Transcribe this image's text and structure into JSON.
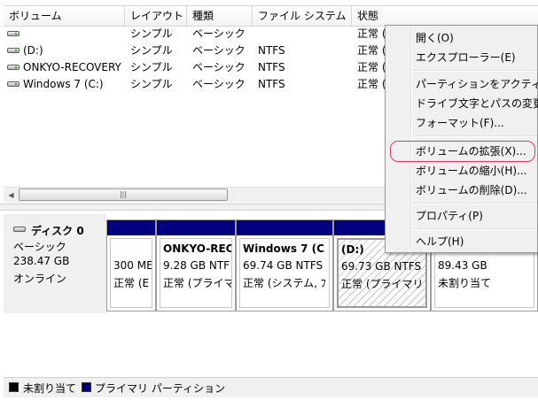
{
  "volume_list": {
    "columns": [
      "ボリューム",
      "レイアウト",
      "種類",
      "ファイル システム",
      "状態"
    ],
    "rows": [
      {
        "volume": "",
        "layout": "シンプル",
        "type": "ベーシック",
        "fs": "",
        "status": "正常 ("
      },
      {
        "volume": "(D:)",
        "layout": "シンプル",
        "type": "ベーシック",
        "fs": "NTFS",
        "status": "正常 ("
      },
      {
        "volume": "ONKYO-RECOVERY",
        "layout": "シンプル",
        "type": "ベーシック",
        "fs": "NTFS",
        "status": "正常 ("
      },
      {
        "volume": "Windows 7 (C:)",
        "layout": "シンプル",
        "type": "ベーシック",
        "fs": "NTFS",
        "status": "正常 ("
      }
    ]
  },
  "disk": {
    "name": "ディスク 0",
    "type": "ベーシック",
    "size": "238.47 GB",
    "status": "オンライン",
    "partitions": [
      {
        "name": "",
        "size": "300 ME",
        "status": "正常 (E"
      },
      {
        "name": "ONKYO-REC",
        "size": "9.28 GB NTF",
        "status": "正常 (プライマ"
      },
      {
        "name": "Windows 7  (C",
        "size": "69.74 GB NTFS",
        "status": "正常 (システム, ﾌ"
      },
      {
        "name": "(D:)",
        "size": "69.73 GB NTFS",
        "status": "正常 (プライマリ"
      },
      {
        "name": "",
        "size": "89.43 GB",
        "status": "未割り当て"
      }
    ]
  },
  "legend": {
    "unallocated": "未割り当て",
    "primary": "プライマリ パーティション",
    "colors": {
      "unallocated": "#000000",
      "primary": "#000080"
    }
  },
  "context_menu": {
    "items": [
      "開く(O)",
      "エクスプローラー(E)",
      "パーティションをアクティ",
      "ドライブ文字とパスの変更",
      "フォーマット(F)...",
      "ボリュームの拡張(X)...",
      "ボリュームの縮小(H)...",
      "ボリュームの削除(D)...",
      "プロパティ(P)",
      "ヘルプ(H)"
    ],
    "highlighted": "ボリュームの拡張(X)...",
    "highlight_color": "#e0366b"
  },
  "icons": {
    "volume": "drive-icon",
    "scroll_left": "scroll-left-arrow-icon",
    "scroll_right": "scroll-right-arrow-icon",
    "scroll_grip": "scroll-grip-icon"
  }
}
